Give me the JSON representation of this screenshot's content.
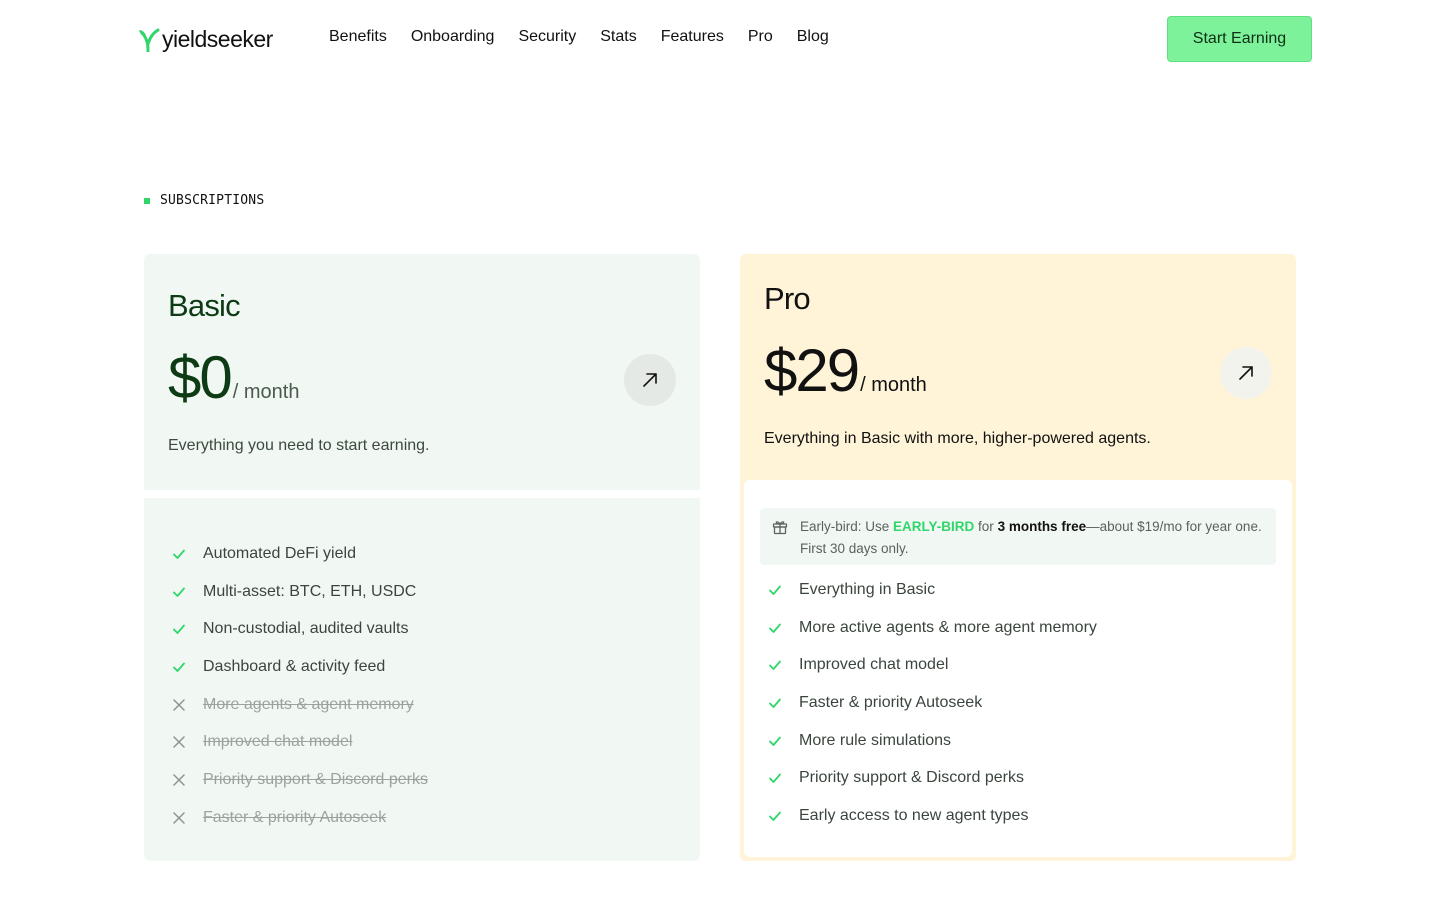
{
  "brand": {
    "name": "yieldseeker",
    "accent": "#2fd66a",
    "cta_color": "#7df29a",
    "pro_bg": "#fff3d8",
    "basic_bg": "#f1f8f3"
  },
  "nav": {
    "items": [
      "Benefits",
      "Onboarding",
      "Security",
      "Stats",
      "Features",
      "Pro",
      "Blog"
    ]
  },
  "header": {
    "cta_label": "Start Earning"
  },
  "section": {
    "label": "SUBSCRIPTIONS"
  },
  "plans": {
    "basic": {
      "name": "Basic",
      "price": "$0",
      "period": "/ month",
      "description": "Everything you need to start earning.",
      "action_icon": "arrow-up-right-icon",
      "features": [
        {
          "label": "Automated DeFi yield",
          "included": true
        },
        {
          "label": "Multi-asset: BTC, ETH, USDC",
          "included": true
        },
        {
          "label": "Non-custodial, audited vaults",
          "included": true
        },
        {
          "label": "Dashboard & activity feed",
          "included": true
        },
        {
          "label": "More agents & agent memory",
          "included": false
        },
        {
          "label": "Improved chat model",
          "included": false
        },
        {
          "label": "Priority support & Discord perks",
          "included": false
        },
        {
          "label": "Faster & priority Autoseek",
          "included": false
        }
      ]
    },
    "pro": {
      "name": "Pro",
      "price": "$29",
      "period": "/ month",
      "description": "Everything in Basic with more, higher-powered agents.",
      "action_icon": "arrow-up-right-icon",
      "promo": {
        "icon": "gift-icon",
        "prefix": "Early-bird:  Use ",
        "code": "EARLY-BIRD",
        "mid": " for ",
        "highlight": "3 months free",
        "suffix": "—about $19/mo for year one. First 30 days only."
      },
      "features": [
        {
          "label": "Everything in Basic",
          "included": true
        },
        {
          "label": "More active agents & more agent memory",
          "included": true
        },
        {
          "label": "Improved chat model",
          "included": true
        },
        {
          "label": "Faster & priority Autoseek",
          "included": true
        },
        {
          "label": "More rule simulations",
          "included": true
        },
        {
          "label": "Priority support & Discord perks",
          "included": true
        },
        {
          "label": "Early access to new agent types",
          "included": true
        }
      ]
    }
  }
}
